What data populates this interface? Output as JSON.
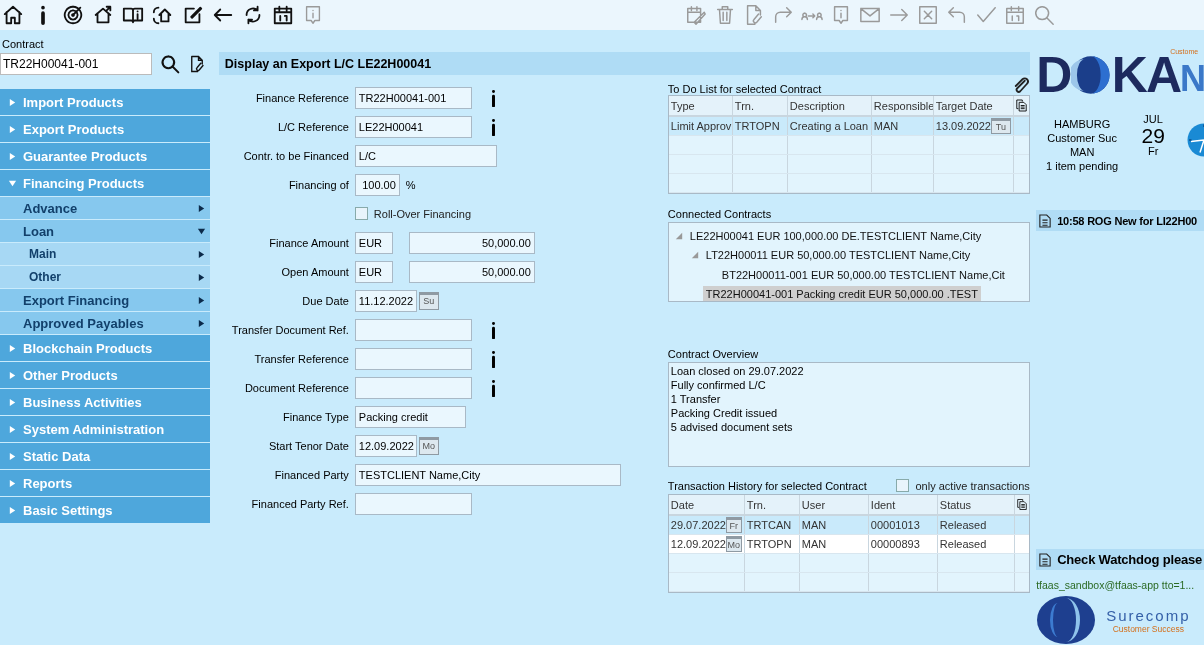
{
  "toolbar": {
    "left_tools": [
      {
        "disabled": false
      },
      {
        "disabled": false
      },
      {
        "disabled": false
      },
      {
        "disabled": false
      },
      {
        "disabled": false
      },
      {
        "disabled": false
      },
      {
        "disabled": false
      },
      {
        "disabled": false
      },
      {
        "disabled": false
      },
      {
        "disabled": false
      },
      {
        "disabled": true
      }
    ],
    "right_tools": [
      {
        "disabled": true
      },
      {
        "disabled": true
      },
      {
        "disabled": true
      },
      {
        "disabled": true
      },
      {
        "disabled": true
      },
      {
        "disabled": true
      },
      {
        "disabled": true
      },
      {
        "disabled": true
      },
      {
        "disabled": true
      },
      {
        "disabled": true
      },
      {
        "disabled": true
      },
      {
        "disabled": true
      },
      {
        "disabled": true
      }
    ]
  },
  "contract": {
    "label": "Contract",
    "value": "TR22H00041-001"
  },
  "nav": [
    {
      "label": "Import Products",
      "expanded": false
    },
    {
      "label": "Export Products",
      "expanded": false
    },
    {
      "label": "Guarantee Products",
      "expanded": false
    },
    {
      "label": "Financing Products",
      "expanded": true,
      "children": [
        {
          "label": "Advance",
          "expanded": false
        },
        {
          "label": "Loan",
          "expanded": true,
          "children": [
            {
              "label": "Main",
              "expanded": false
            },
            {
              "label": "Other",
              "expanded": false
            }
          ]
        },
        {
          "label": "Export Financing",
          "expanded": false
        },
        {
          "label": "Approved Payables",
          "expanded": false
        }
      ]
    },
    {
      "label": "Blockchain Products",
      "expanded": false
    },
    {
      "label": "Other Products",
      "expanded": false
    },
    {
      "label": "Business Activities",
      "expanded": false
    },
    {
      "label": "System Administration",
      "expanded": false
    },
    {
      "label": "Static Data",
      "expanded": false
    },
    {
      "label": "Reports",
      "expanded": false
    },
    {
      "label": "Basic Settings",
      "expanded": false
    }
  ],
  "page_title": "Display an Export L/C LE22H00041",
  "form": [
    {
      "kind": "text",
      "label": "Finance Reference",
      "value": "TR22H00041-001",
      "info": true
    },
    {
      "kind": "text",
      "label": "L/C Reference",
      "value": "LE22H00041",
      "info": true
    },
    {
      "kind": "combo",
      "label": "Contr. to be Financed",
      "value": "L/C"
    },
    {
      "kind": "percent",
      "label": "Financing of",
      "value": "100.00",
      "unit": "%"
    },
    {
      "kind": "checkbox",
      "label": "Roll-Over Financing",
      "checked": false
    },
    {
      "kind": "amount",
      "label": "Finance Amount",
      "currency": "EUR",
      "value": "50,000.00"
    },
    {
      "kind": "amount",
      "label": "Open Amount",
      "currency": "EUR",
      "value": "50,000.00"
    },
    {
      "kind": "date",
      "label": "Due Date",
      "value": "11.12.2022",
      "day": "Su"
    },
    {
      "kind": "text",
      "label": "Transfer Document Ref.",
      "info": true
    },
    {
      "kind": "text",
      "label": "Transfer Reference",
      "info": true
    },
    {
      "kind": "text",
      "label": "Document Reference",
      "info": true
    },
    {
      "kind": "short",
      "label": "Finance Type",
      "value": "Packing credit"
    },
    {
      "kind": "date",
      "label": "Start Tenor Date",
      "value": "12.09.2022",
      "day": "Mo"
    },
    {
      "kind": "long",
      "label": "Financed Party",
      "value": "TESTCLIENT Name,City"
    },
    {
      "kind": "text",
      "label": "Financed Party Ref."
    }
  ],
  "todo": {
    "title": "To Do List for selected Contract",
    "columns": [
      "Type",
      "Trn.",
      "Description",
      "Responsible",
      "Target Date"
    ],
    "rows": [
      {
        "selected": true,
        "cells": [
          "Limit Approv",
          "TRTOPN",
          "Creating a Loan",
          "MAN",
          "13.09.2022"
        ],
        "day": "Tu"
      }
    ]
  },
  "connected": {
    "title": "Connected Contracts",
    "tree": [
      {
        "label": "LE22H00041 EUR 100,000.00 DE.TESTCLIENT Name,City",
        "expanded": true,
        "selected": false,
        "children": [
          {
            "label": "LT22H00011 EUR 50,000.00 TESTCLIENT Name,City",
            "expanded": true,
            "selected": false,
            "children": [
              {
                "label": "BT22H00011-001 EUR 50,000.00 TESTCLIENT Name,Cit",
                "selected": false
              }
            ]
          },
          {
            "label": "TR22H00041-001 Packing credit EUR 50,000.00 .TEST",
            "selected": true
          }
        ]
      }
    ]
  },
  "overview": {
    "title": "Contract Overview",
    "lines": [
      "Loan closed on 29.07.2022",
      "Fully confirmed L/C",
      "1 Transfer",
      "Packing Credit issued",
      "5 advised document sets"
    ]
  },
  "history": {
    "title": "Transaction History for selected Contract",
    "filter": {
      "label": "only active transactions",
      "checked": false
    },
    "columns": [
      "Date",
      "Trn.",
      "User",
      "Ident",
      "Status"
    ],
    "rows": [
      {
        "selected": true,
        "day": "Fr",
        "cells": [
          "29.07.2022",
          "TRTCAN",
          "MAN",
          "00001013",
          "Released"
        ]
      },
      {
        "selected": false,
        "day": "Mo",
        "cells": [
          "12.09.2022",
          "TRTOPN",
          "MAN",
          "00000893",
          "Released"
        ]
      }
    ]
  },
  "side": {
    "logo": {
      "first": "D",
      "rest": "KA",
      "tail": "N",
      "tag": "Custome"
    },
    "info": [
      "HAMBURG",
      "Customer Suc",
      "MAN",
      "1 item pending"
    ],
    "date": {
      "month": "JUL",
      "day": "29",
      "weekday": "Fr"
    },
    "notices": [
      {
        "text": "10:58 ROG New for LI22H00"
      }
    ],
    "watchdog": "Check Watchdog please",
    "user": "tfaas_sandbox@tfaas-app tto=1...",
    "brand": {
      "name": "Surecomp",
      "slogan": "Customer Success"
    }
  }
}
